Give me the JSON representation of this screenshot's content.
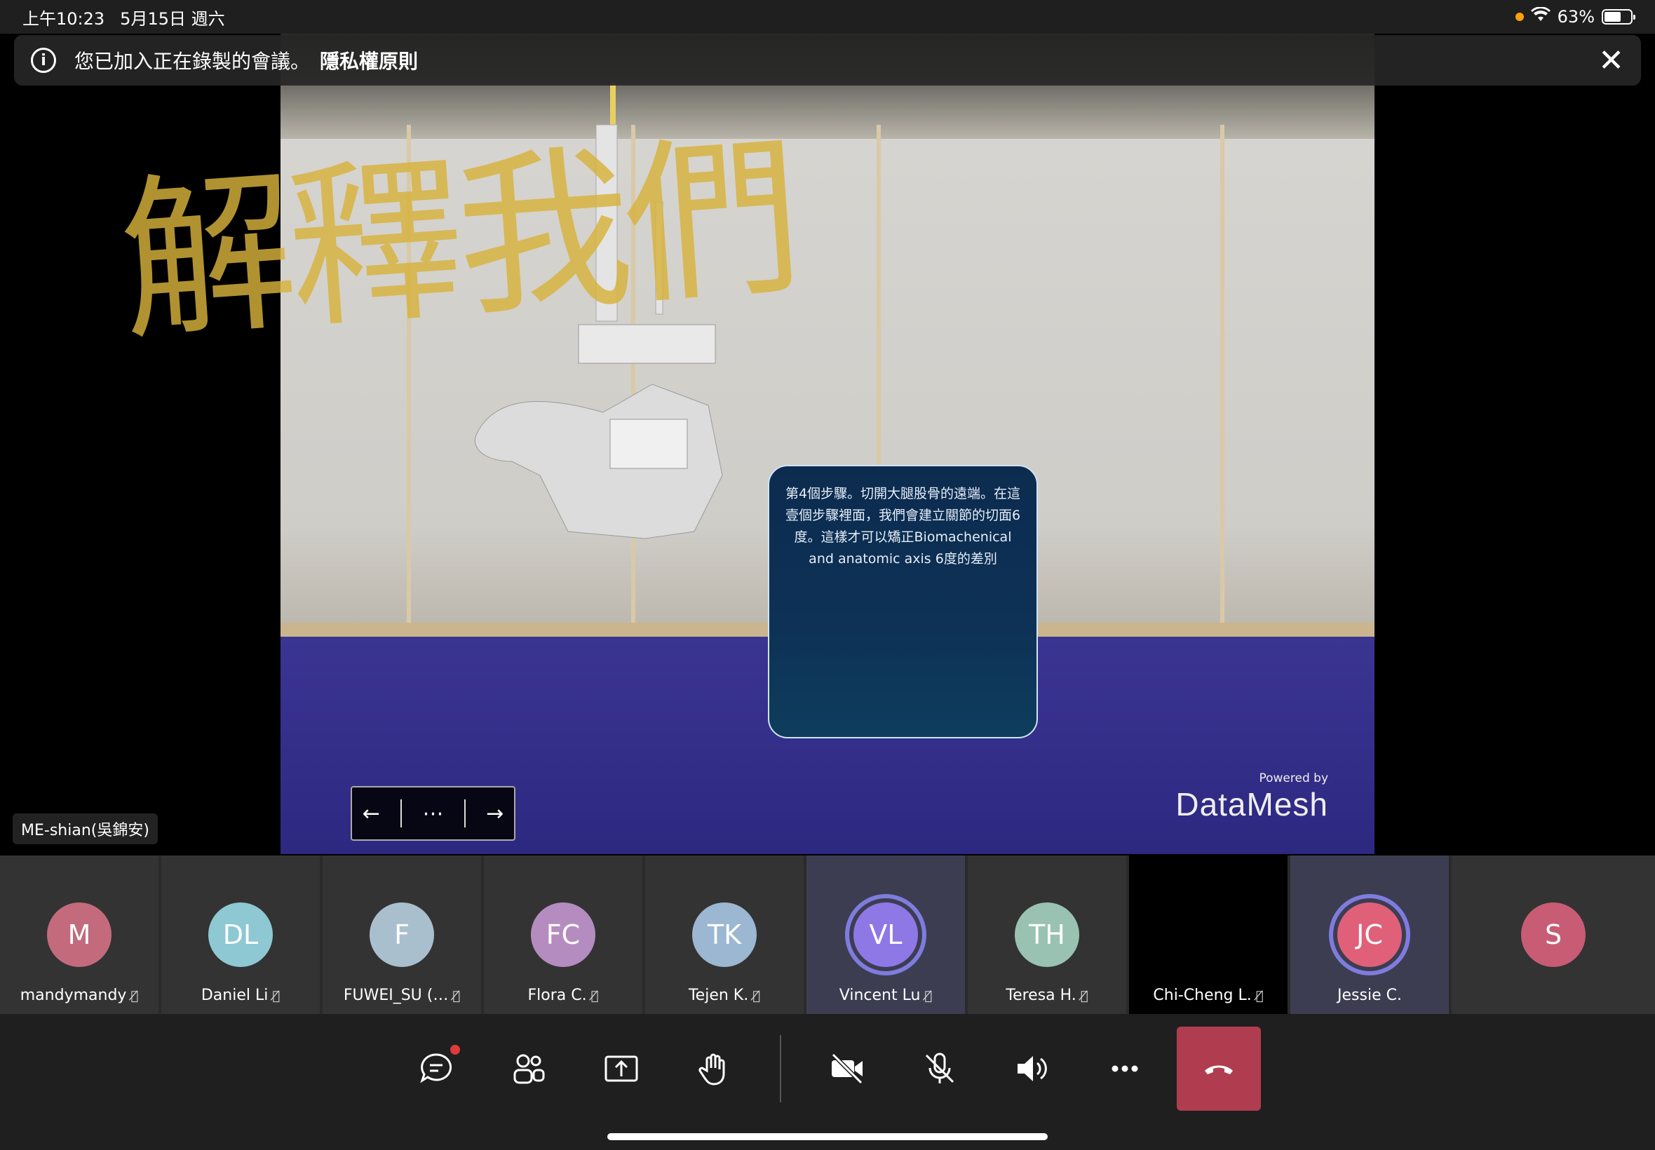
{
  "status_bar": {
    "time": "上午10:23",
    "date": "5月15日 週六",
    "battery": "63%"
  },
  "banner": {
    "message": "您已加入正在錄製的會議。",
    "link": "隱私權原則"
  },
  "stage": {
    "card_text": "第4個步驟。切開大腿股骨的遠端。在這壹個步驟裡面，我們會建立關節的切面6度。這樣才可以矯正Biomachenical and anatomic axis 6度的差別",
    "powered_by": "Powered by",
    "brand": "DataMesh",
    "nav": {
      "prev": "←",
      "more": "⋯",
      "next": "→"
    },
    "watermark": "解釋我們",
    "speaker": "ME-shian(吳錦安)"
  },
  "participants": [
    {
      "initials": "M",
      "name": "mandymandy",
      "color": "#c36b7c"
    },
    {
      "initials": "DL",
      "name": "Daniel Li",
      "color": "#8ec8d2"
    },
    {
      "initials": "F",
      "name": "FUWEI_SU (…",
      "color": "#a9bfcd"
    },
    {
      "initials": "FC",
      "name": "Flora C.",
      "color": "#b58cc0"
    },
    {
      "initials": "TK",
      "name": "Tejen K.",
      "color": "#9bb7d1"
    },
    {
      "initials": "VL",
      "name": "Vincent Lu",
      "color": "#8e78e6"
    },
    {
      "initials": "TH",
      "name": "Teresa H.",
      "color": "#99c2b2"
    },
    {
      "initials": "",
      "name": "Chi-Cheng L.",
      "color": "#000000"
    },
    {
      "initials": "JC",
      "name": "Jessie C.",
      "color": "#e0607a"
    },
    {
      "initials": "S",
      "name": "",
      "color": "#c75c74"
    }
  ],
  "controls": [
    "chat-icon",
    "people-icon",
    "share-icon",
    "raise-hand-icon",
    "camera-off-icon",
    "mic-off-icon",
    "speaker-icon",
    "more-icon",
    "hang-up-icon"
  ]
}
